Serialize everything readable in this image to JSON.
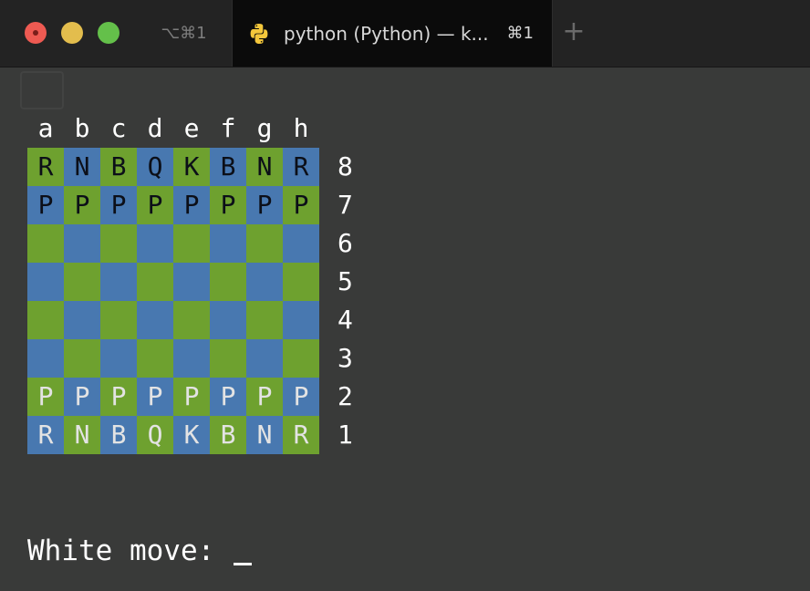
{
  "tabs": {
    "inactive_shortcut": "⌥⌘1",
    "active_title": "python (Python) — k...",
    "active_shortcut": "⌘1",
    "new_tab_symbol": "+"
  },
  "colors": {
    "light_square": "#6ea12f",
    "dark_square": "#4878b0",
    "terminal_bg": "#393a39"
  },
  "board": {
    "files": [
      "a",
      "b",
      "c",
      "d",
      "e",
      "f",
      "g",
      "h"
    ],
    "ranks": [
      "8",
      "7",
      "6",
      "5",
      "4",
      "3",
      "2",
      "1"
    ],
    "rows": [
      [
        "R",
        "N",
        "B",
        "Q",
        "K",
        "B",
        "N",
        "R"
      ],
      [
        "P",
        "P",
        "P",
        "P",
        "P",
        "P",
        "P",
        "P"
      ],
      [
        "",
        "",
        "",
        "",
        "",
        "",
        "",
        ""
      ],
      [
        "",
        "",
        "",
        "",
        "",
        "",
        "",
        ""
      ],
      [
        "",
        "",
        "",
        "",
        "",
        "",
        "",
        ""
      ],
      [
        "",
        "",
        "",
        "",
        "",
        "",
        "",
        ""
      ],
      [
        "P",
        "P",
        "P",
        "P",
        "P",
        "P",
        "P",
        "P"
      ],
      [
        "R",
        "N",
        "B",
        "Q",
        "K",
        "B",
        "N",
        "R"
      ]
    ]
  },
  "prompt": {
    "text": "White move: "
  }
}
